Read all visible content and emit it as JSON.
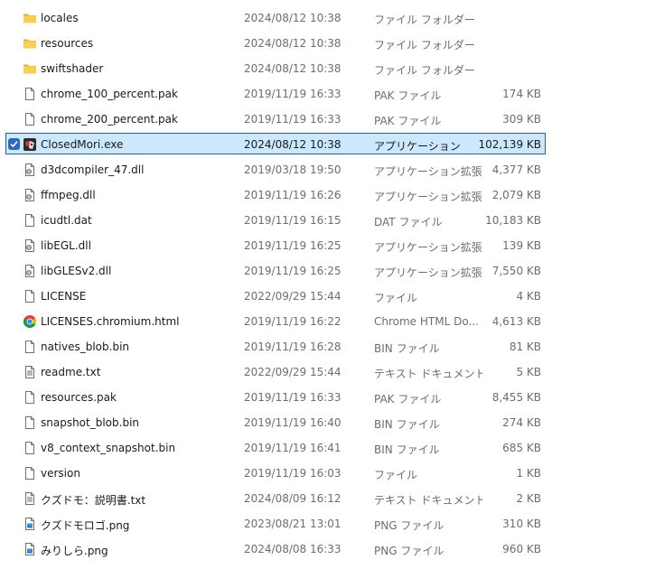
{
  "file_list": {
    "selected_index": 5,
    "items": [
      {
        "name": "locales",
        "date": "2024/08/12 10:38",
        "type": "ファイル フォルダー",
        "size": "",
        "icon": "folder-icon"
      },
      {
        "name": "resources",
        "date": "2024/08/12 10:38",
        "type": "ファイル フォルダー",
        "size": "",
        "icon": "folder-icon"
      },
      {
        "name": "swiftshader",
        "date": "2024/08/12 10:38",
        "type": "ファイル フォルダー",
        "size": "",
        "icon": "folder-icon"
      },
      {
        "name": "chrome_100_percent.pak",
        "date": "2019/11/19 16:33",
        "type": "PAK ファイル",
        "size": "174 KB",
        "icon": "file-icon"
      },
      {
        "name": "chrome_200_percent.pak",
        "date": "2019/11/19 16:33",
        "type": "PAK ファイル",
        "size": "309 KB",
        "icon": "file-icon"
      },
      {
        "name": "ClosedMori.exe",
        "date": "2024/08/12 10:38",
        "type": "アプリケーション",
        "size": "102,139 KB",
        "icon": "app-exe-icon"
      },
      {
        "name": "d3dcompiler_47.dll",
        "date": "2019/03/18 19:50",
        "type": "アプリケーション拡張",
        "size": "4,377 KB",
        "icon": "dll-icon"
      },
      {
        "name": "ffmpeg.dll",
        "date": "2019/11/19 16:26",
        "type": "アプリケーション拡張",
        "size": "2,079 KB",
        "icon": "dll-icon"
      },
      {
        "name": "icudtl.dat",
        "date": "2019/11/19 16:15",
        "type": "DAT ファイル",
        "size": "10,183 KB",
        "icon": "file-icon"
      },
      {
        "name": "libEGL.dll",
        "date": "2019/11/19 16:25",
        "type": "アプリケーション拡張",
        "size": "139 KB",
        "icon": "dll-icon"
      },
      {
        "name": "libGLESv2.dll",
        "date": "2019/11/19 16:25",
        "type": "アプリケーション拡張",
        "size": "7,550 KB",
        "icon": "dll-icon"
      },
      {
        "name": "LICENSE",
        "date": "2022/09/29 15:44",
        "type": "ファイル",
        "size": "4 KB",
        "icon": "file-icon"
      },
      {
        "name": "LICENSES.chromium.html",
        "date": "2019/11/19 16:22",
        "type": "Chrome HTML Do...",
        "size": "4,613 KB",
        "icon": "chrome-icon"
      },
      {
        "name": "natives_blob.bin",
        "date": "2019/11/19 16:28",
        "type": "BIN ファイル",
        "size": "81 KB",
        "icon": "file-icon"
      },
      {
        "name": "readme.txt",
        "date": "2022/09/29 15:44",
        "type": "テキスト ドキュメント",
        "size": "5 KB",
        "icon": "text-file-icon"
      },
      {
        "name": "resources.pak",
        "date": "2019/11/19 16:33",
        "type": "PAK ファイル",
        "size": "8,455 KB",
        "icon": "file-icon"
      },
      {
        "name": "snapshot_blob.bin",
        "date": "2019/11/19 16:40",
        "type": "BIN ファイル",
        "size": "274 KB",
        "icon": "file-icon"
      },
      {
        "name": "v8_context_snapshot.bin",
        "date": "2019/11/19 16:41",
        "type": "BIN ファイル",
        "size": "685 KB",
        "icon": "file-icon"
      },
      {
        "name": "version",
        "date": "2019/11/19 16:03",
        "type": "ファイル",
        "size": "1 KB",
        "icon": "file-icon"
      },
      {
        "name": "クズドモ：説明書.txt",
        "date": "2024/08/09 16:12",
        "type": "テキスト ドキュメント",
        "size": "2 KB",
        "icon": "text-file-icon"
      },
      {
        "name": "クズドモロゴ.png",
        "date": "2023/08/21 13:01",
        "type": "PNG ファイル",
        "size": "310 KB",
        "icon": "image-file-icon"
      },
      {
        "name": "みりしら.png",
        "date": "2024/08/08 16:33",
        "type": "PNG ファイル",
        "size": "960 KB",
        "icon": "image-file-icon"
      }
    ]
  },
  "colors": {
    "folder": "#f2c94c",
    "selection_bg": "#cce8ff",
    "selection_border": "#2c628b",
    "checkbox": "#2a6bbf"
  }
}
